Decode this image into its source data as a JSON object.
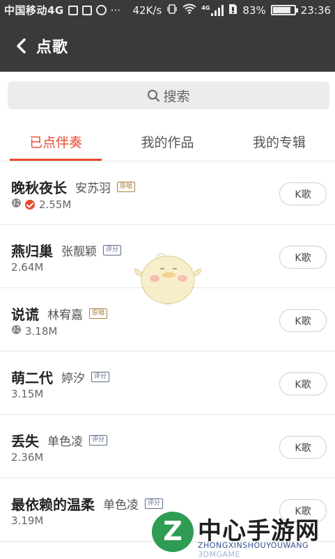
{
  "status_bar": {
    "carrier": "中国移动4G",
    "speed": "42K/s",
    "network": "4G",
    "battery": "83%",
    "battery_level": 0.83,
    "time": "23:36"
  },
  "nav": {
    "title": "点歌"
  },
  "search": {
    "placeholder": "搜索"
  },
  "tabs": [
    {
      "label": "已点伴奏",
      "active": true
    },
    {
      "label": "我的作品",
      "active": false
    },
    {
      "label": "我的专辑",
      "active": false
    }
  ],
  "songs": [
    {
      "title": "晚秋夜长",
      "artist": "安苏羽",
      "tag": "原唱",
      "size": "2.55M",
      "icons": [
        "globe-icon",
        "check-icon"
      ],
      "button": "K歌"
    },
    {
      "title": "燕归巢",
      "artist": "张靓颖",
      "tag": "评分",
      "size": "2.64M",
      "icons": [],
      "button": "K歌"
    },
    {
      "title": "说谎",
      "artist": "林宥嘉",
      "tag": "原唱",
      "size": "3.18M",
      "icons": [
        "globe-icon"
      ],
      "button": "K歌"
    },
    {
      "title": "萌二代",
      "artist": "婷汐",
      "tag": "评分",
      "size": "3.15M",
      "icons": [],
      "button": "K歌"
    },
    {
      "title": "丢失",
      "artist": "单色凌",
      "tag": "评分",
      "size": "2.36M",
      "icons": [],
      "button": "K歌"
    },
    {
      "title": "最依赖的温柔",
      "artist": "单色凌",
      "tag": "评分",
      "size": "3.19M",
      "icons": [],
      "button": "K歌"
    }
  ],
  "watermark": {
    "text": "中心手游网",
    "subtext": "ZHONGXINSHOUYOUWANG",
    "overlay": "3DMGAME"
  },
  "colors": {
    "accent": "#e8482f",
    "header_bg": "#3b3a38",
    "tag_original": "#a9813c",
    "tag_rating": "#5a6a8a"
  }
}
